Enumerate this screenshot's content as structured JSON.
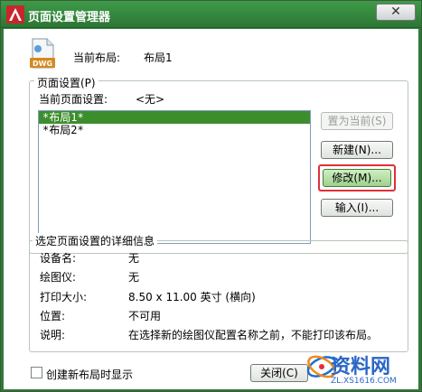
{
  "window": {
    "title": "页面设置管理器",
    "close_label": "✕"
  },
  "current_layout": {
    "label": "当前布局:",
    "value": "布局1",
    "icon_text": "DWG"
  },
  "page_setups": {
    "group_label": "页面设置(P)",
    "current_label": "当前页面设置:",
    "current_value": "<无>",
    "items": [
      "*布局1*",
      "*布局2*"
    ]
  },
  "buttons": {
    "set_current": "置为当前(S)",
    "new": "新建(N)...",
    "modify": "修改(M)...",
    "import": "输入(I)..."
  },
  "details": {
    "group_label": "选定页面设置的详细信息",
    "rows": [
      {
        "key": "设备名:",
        "value": "无"
      },
      {
        "key": "绘图仪:",
        "value": "无"
      },
      {
        "key": "打印大小:",
        "value": "8.50 x 11.00 英寸 (横向)"
      },
      {
        "key": "位置:",
        "value": "不可用"
      },
      {
        "key": "说明:",
        "value": "在选择新的绘图仪配置名称之前，不能打印该布局。"
      }
    ]
  },
  "footer": {
    "checkbox_label": "创建新布局时显示",
    "checkbox_checked": false,
    "close_button": "关闭(C)"
  },
  "watermark": {
    "brand": "资料网",
    "url": "ZL.XS1616.COM"
  },
  "colors": {
    "title_bar": "#2f7a38",
    "selection": "#3c8e2c",
    "highlight_frame": "#e0303a"
  }
}
